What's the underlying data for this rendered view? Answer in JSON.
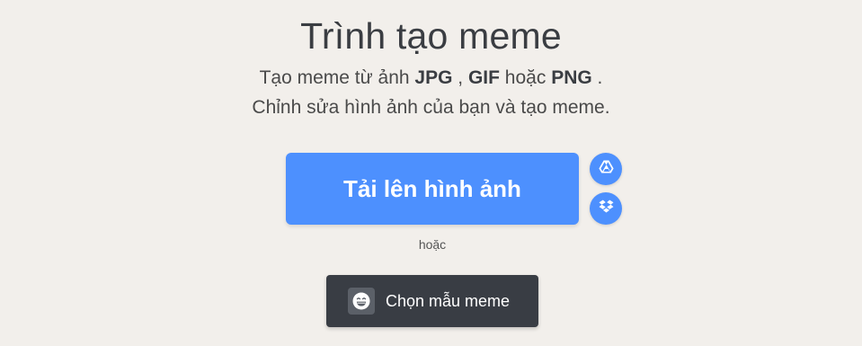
{
  "header": {
    "title": "Trình tạo meme",
    "line1_prefix": "Tạo meme từ ảnh ",
    "format_jpg": "JPG",
    "sep1": " , ",
    "format_gif": "GIF",
    "sep2": " hoặc ",
    "format_png": "PNG",
    "line1_suffix": " .",
    "line2": "Chỉnh sửa hình ảnh của bạn và tạo meme."
  },
  "upload": {
    "label": "Tải lên hình ảnh",
    "drive_icon": "google-drive-icon",
    "dropbox_icon": "dropbox-icon"
  },
  "or_label": "hoặc",
  "template": {
    "label": "Chọn mẫu meme",
    "icon": "grinning-face-icon"
  },
  "colors": {
    "background": "#f2efeb",
    "primary": "#4d90fe",
    "dark_button": "#393d44",
    "text": "#3a3d42"
  }
}
